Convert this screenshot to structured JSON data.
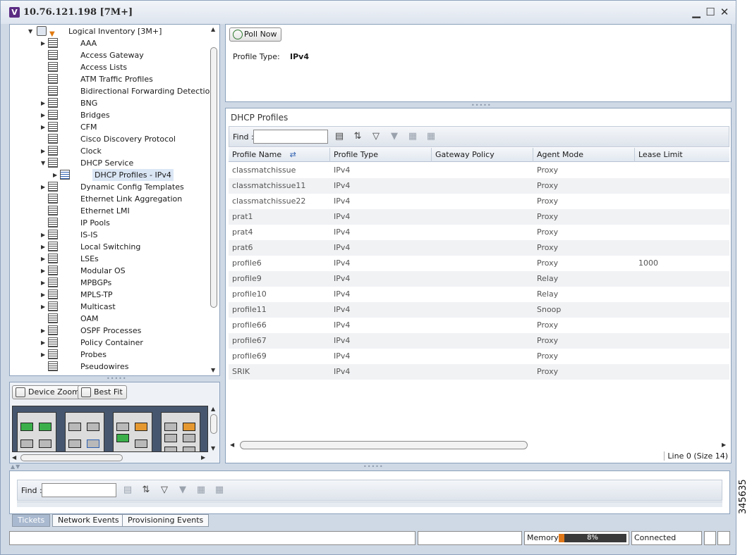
{
  "window": {
    "badge": "V",
    "title": "10.76.121.198 [7M+]",
    "minimize": "▁",
    "maximize": "☐",
    "close": "✕"
  },
  "tree": {
    "root_label": "Logical Inventory [3M+]",
    "items": [
      {
        "label": "AAA",
        "expandable": true
      },
      {
        "label": "Access Gateway",
        "expandable": false
      },
      {
        "label": "Access Lists",
        "expandable": false
      },
      {
        "label": "ATM Traffic Profiles",
        "expandable": false
      },
      {
        "label": "Bidirectional Forwarding Detection",
        "expandable": false
      },
      {
        "label": "BNG",
        "expandable": true
      },
      {
        "label": "Bridges",
        "expandable": true
      },
      {
        "label": "CFM",
        "expandable": true
      },
      {
        "label": "Cisco Discovery Protocol",
        "expandable": false
      },
      {
        "label": "Clock",
        "expandable": true
      },
      {
        "label": "DHCP Service",
        "expandable": true,
        "expanded": true
      },
      {
        "label": "DHCP Profiles - IPv4",
        "expandable": true,
        "child": true,
        "selected": true
      },
      {
        "label": "Dynamic Config Templates",
        "expandable": true
      },
      {
        "label": "Ethernet Link Aggregation",
        "expandable": false
      },
      {
        "label": "Ethernet LMI",
        "expandable": false
      },
      {
        "label": "IP Pools",
        "expandable": false
      },
      {
        "label": "IS-IS",
        "expandable": true
      },
      {
        "label": "Local Switching",
        "expandable": true
      },
      {
        "label": "LSEs",
        "expandable": true
      },
      {
        "label": "Modular OS",
        "expandable": true
      },
      {
        "label": "MPBGPs",
        "expandable": true
      },
      {
        "label": "MPLS-TP",
        "expandable": true
      },
      {
        "label": "Multicast",
        "expandable": true
      },
      {
        "label": "OAM",
        "expandable": false
      },
      {
        "label": "OSPF Processes",
        "expandable": true
      },
      {
        "label": "Policy Container",
        "expandable": true
      },
      {
        "label": "Probes",
        "expandable": true
      },
      {
        "label": "Pseudowires",
        "expandable": false
      }
    ]
  },
  "zoom": {
    "device_zoom": "Device Zoom",
    "best_fit": "Best Fit"
  },
  "properties": {
    "poll_now": "Poll Now",
    "profile_type_label": "Profile Type:",
    "profile_type_value": "IPv4"
  },
  "dhcp_table": {
    "section_title": "DHCP Profiles",
    "find_label": "Find :",
    "columns": [
      "Profile Name",
      "Profile Type",
      "Gateway Policy",
      "Agent Mode",
      "Lease Limit"
    ],
    "rows": [
      [
        "classmatchissue",
        "IPv4",
        "",
        "Proxy",
        ""
      ],
      [
        "classmatchissue11",
        "IPv4",
        "",
        "Proxy",
        ""
      ],
      [
        "classmatchissue22",
        "IPv4",
        "",
        "Proxy",
        ""
      ],
      [
        "prat1",
        "IPv4",
        "",
        "Proxy",
        ""
      ],
      [
        "prat4",
        "IPv4",
        "",
        "Proxy",
        ""
      ],
      [
        "prat6",
        "IPv4",
        "",
        "Proxy",
        ""
      ],
      [
        "profile6",
        "IPv4",
        "",
        "Proxy",
        "1000"
      ],
      [
        "profile9",
        "IPv4",
        "",
        "Relay",
        ""
      ],
      [
        "profile10",
        "IPv4",
        "",
        "Relay",
        ""
      ],
      [
        "profile11",
        "IPv4",
        "",
        "Snoop",
        ""
      ],
      [
        "profile66",
        "IPv4",
        "",
        "Proxy",
        ""
      ],
      [
        "profile67",
        "IPv4",
        "",
        "Proxy",
        ""
      ],
      [
        "profile69",
        "IPv4",
        "",
        "Proxy",
        ""
      ],
      [
        "SRIK",
        "IPv4",
        "",
        "Proxy",
        ""
      ]
    ],
    "status": "Line 0 (Size 14)"
  },
  "bottom": {
    "find_label": "Find :",
    "tabs": [
      "Tickets",
      "Network Events",
      "Provisioning Events"
    ],
    "active_tab": 0
  },
  "statusbar": {
    "memory_label": "Memory:",
    "memory_percent": 8,
    "memory_text": "8%",
    "connection": "Connected"
  },
  "figure_id": "345635",
  "colors": {
    "window_bg": "#cfd9e6",
    "selection": "#dbe6f5",
    "memory_fill": "#e0781a"
  }
}
